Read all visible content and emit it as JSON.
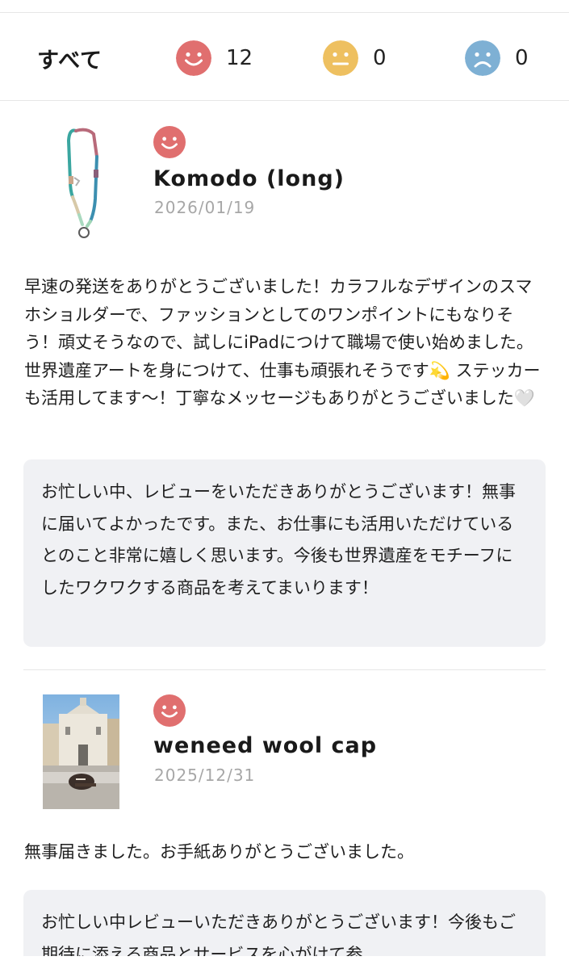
{
  "filter": {
    "all_label": "すべて",
    "good_count": "12",
    "neutral_count": "0",
    "bad_count": "0",
    "colors": {
      "good": "#e06f6f",
      "neutral": "#eec060",
      "bad": "#7eb0d4"
    }
  },
  "reviews": [
    {
      "mood": "good",
      "product_name": "Komodo (long)",
      "date": "2026/01/19",
      "text": "早速の発送をありがとうございました！カラフルなデザインのスマホショルダーで、ファッションとしてのワンポイントにもなりそう！頑丈そうなので、試しにiPadにつけて職場で使い始めました。世界遺産アートを身につけて、仕事も頑張れそうです💫 ステッカーも活用してます〜！丁寧なメッセージもありがとうございました🤍",
      "reply": "お忙しい中、レビューをいただきありがとうございます！無事に届いてよかったです。また、お仕事にも活用いただけているとのこと非常に嬉しく思います。今後も世界遺産をモチーフにしたワクワクする商品を考えてまいります！"
    },
    {
      "mood": "good",
      "product_name": "weneed wool cap",
      "date": "2025/12/31",
      "text": "無事届きました。お手紙ありがとうございました。",
      "reply": "お忙しい中レビューいただきありがとうございます！今後もご期待に添える商品とサービスを心がけて参"
    }
  ]
}
